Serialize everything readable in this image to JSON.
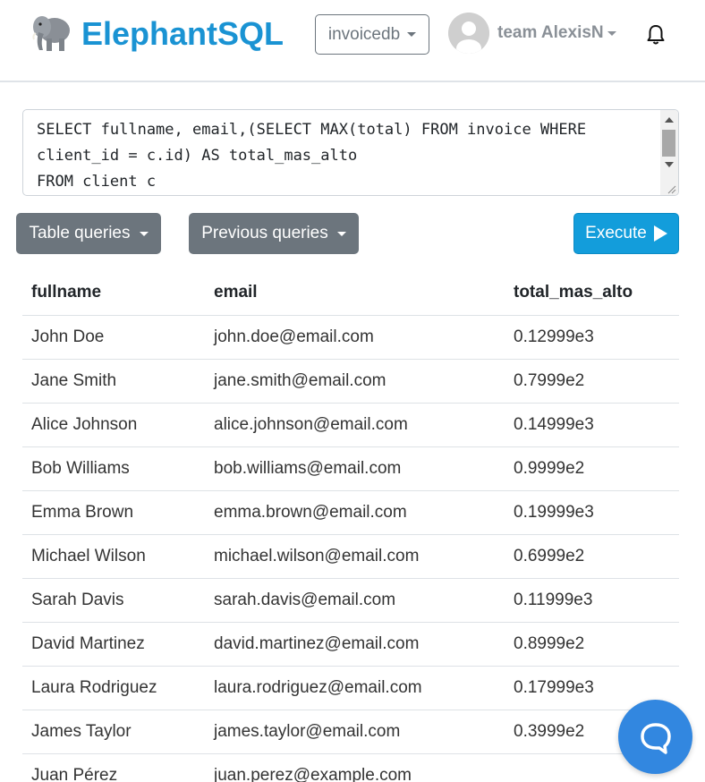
{
  "header": {
    "brand": "ElephantSQL",
    "db_selected": "invoicedb",
    "user": "team AlexisN"
  },
  "query": {
    "text": "SELECT fullname, email,(SELECT MAX(total) FROM invoice WHERE\nclient_id = c.id) AS total_mas_alto\nFROM client c"
  },
  "toolbar": {
    "table_queries_label": "Table queries",
    "previous_queries_label": "Previous queries",
    "execute_label": "Execute"
  },
  "table": {
    "columns": [
      "fullname",
      "email",
      "total_mas_alto"
    ],
    "rows": [
      [
        "John Doe",
        "john.doe@email.com",
        "0.12999e3"
      ],
      [
        "Jane Smith",
        "jane.smith@email.com",
        "0.7999e2"
      ],
      [
        "Alice Johnson",
        "alice.johnson@email.com",
        "0.14999e3"
      ],
      [
        "Bob Williams",
        "bob.williams@email.com",
        "0.9999e2"
      ],
      [
        "Emma Brown",
        "emma.brown@email.com",
        "0.19999e3"
      ],
      [
        "Michael Wilson",
        "michael.wilson@email.com",
        "0.6999e2"
      ],
      [
        "Sarah Davis",
        "sarah.davis@email.com",
        "0.11999e3"
      ],
      [
        "David Martinez",
        "david.martinez@email.com",
        "0.8999e2"
      ],
      [
        "Laura Rodriguez",
        "laura.rodriguez@email.com",
        "0.17999e3"
      ],
      [
        "James Taylor",
        "james.taylor@email.com",
        "0.3999e2"
      ],
      [
        "Juan Pérez",
        "juan.perez@example.com",
        ""
      ]
    ]
  },
  "colors": {
    "brand": "#1a93d3",
    "execute": "#139ddb",
    "secondary": "#6c757d",
    "chat": "#3287e0"
  },
  "icons": {
    "logo": "elephant-logo-icon",
    "bell": "bell-icon",
    "chat": "chat-bubble-icon",
    "play": "play-icon"
  }
}
